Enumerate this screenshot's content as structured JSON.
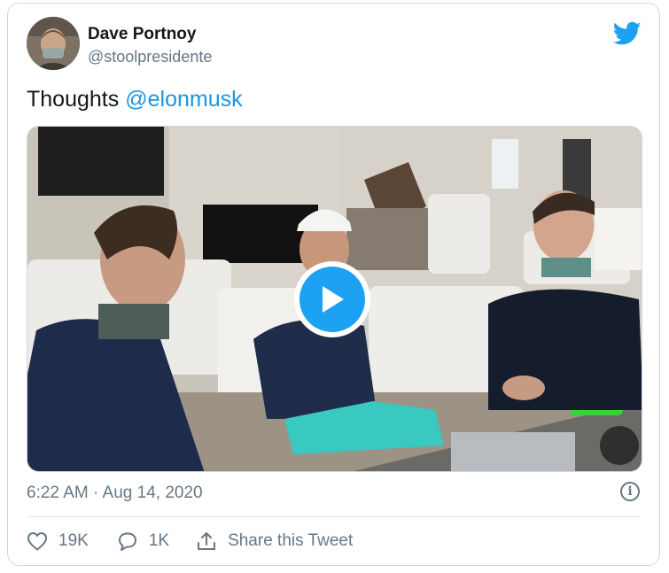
{
  "author": {
    "name": "Dave Portnoy",
    "handle": "@stoolpresidente",
    "avatar_icon": "profile-photo"
  },
  "tweet": {
    "text": "Thoughts",
    "mention": "@elonmusk"
  },
  "media": {
    "type": "video",
    "play_icon": "play-icon"
  },
  "meta": {
    "timestamp": "6:22 AM · Aug 14, 2020",
    "info_icon": "info-icon",
    "info_glyph": "i"
  },
  "actions": {
    "likes": "19K",
    "replies": "1K",
    "share_label": "Share this Tweet"
  },
  "colors": {
    "brand": "#1da1f2",
    "mention": "#1b95e0",
    "secondary_text": "#657786",
    "border": "#cfd9de"
  }
}
